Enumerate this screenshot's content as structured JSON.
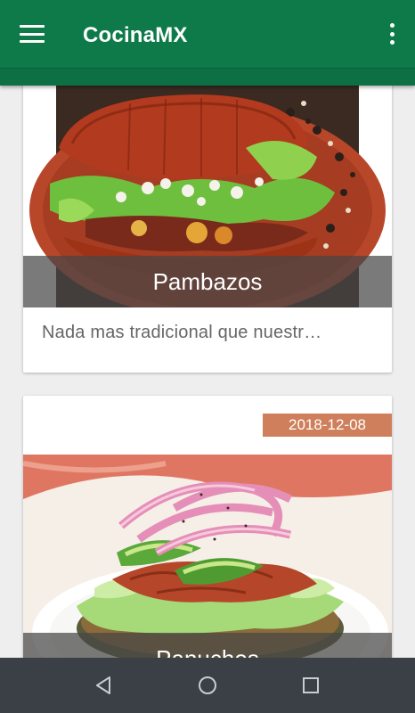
{
  "app_bar": {
    "title": "CocinaMX",
    "menu_icon": "hamburger-menu-icon",
    "overflow_icon": "more-vert-icon",
    "color": "#0f7a49"
  },
  "cards": [
    {
      "title": "Pambazos",
      "description": "Nada mas tradicional que nuestr…",
      "image": "pambazo-food-photo"
    },
    {
      "date": "2018-12-08",
      "title": "Panuchos",
      "image": "panucho-food-photo",
      "badge_color": "#cf7f5b"
    }
  ],
  "nav_bar": {
    "back_icon": "back-triangle-icon",
    "home_icon": "home-circle-icon",
    "recents_icon": "recents-square-icon"
  }
}
